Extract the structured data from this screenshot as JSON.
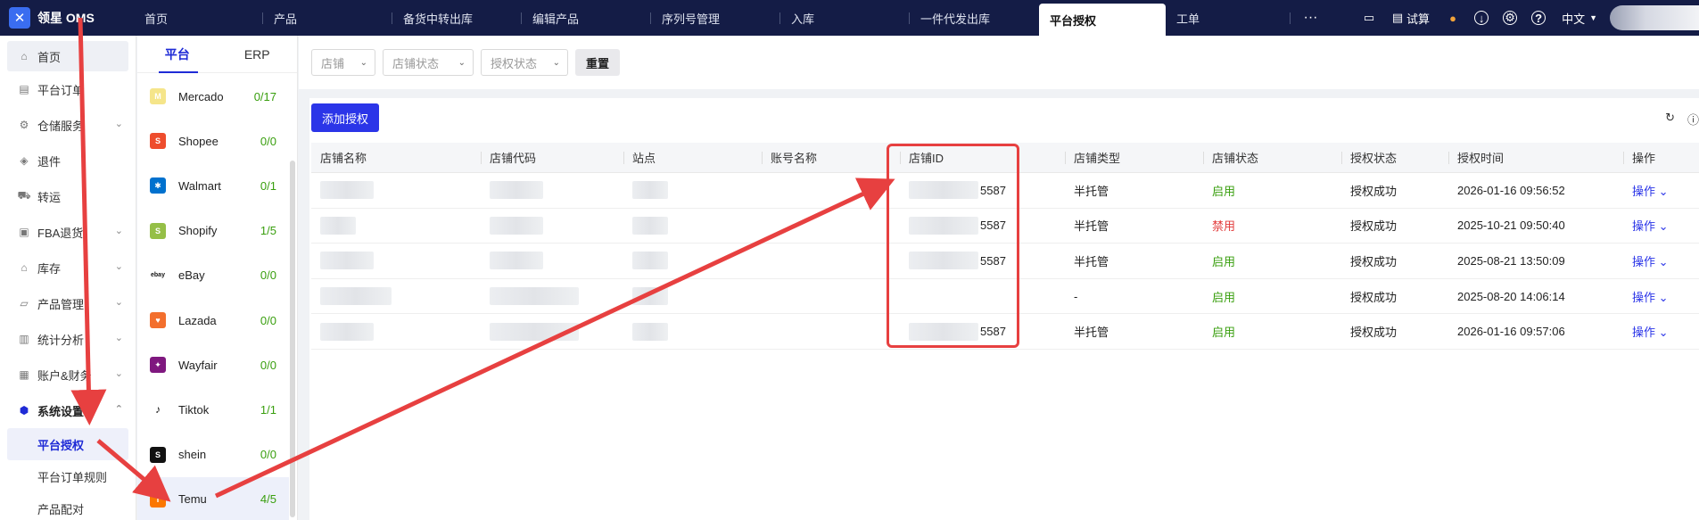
{
  "app": {
    "title": "领星 OMS"
  },
  "nav": {
    "tabs": [
      {
        "label": "首页"
      },
      {
        "label": "产品"
      },
      {
        "label": "备货中转出库"
      },
      {
        "label": "编辑产品"
      },
      {
        "label": "序列号管理"
      },
      {
        "label": "入库"
      },
      {
        "label": "一件代发出库"
      },
      {
        "label": "平台授权",
        "active": true
      },
      {
        "label": "工单"
      }
    ],
    "more": "···",
    "right": {
      "trial": "试算",
      "lang": "中文"
    }
  },
  "sidebar": {
    "items": [
      {
        "label": "首页",
        "icon": "home-icon"
      },
      {
        "label": "平台订单",
        "icon": "order-icon"
      },
      {
        "label": "仓储服务",
        "icon": "warehouse-icon",
        "chevron": "⌄"
      },
      {
        "label": "退件",
        "icon": "return-icon"
      },
      {
        "label": "转运",
        "icon": "transfer-icon"
      },
      {
        "label": "FBA退货",
        "icon": "fba-icon",
        "chevron": "⌄"
      },
      {
        "label": "库存",
        "icon": "inventory-icon",
        "chevron": "⌄"
      },
      {
        "label": "产品管理",
        "icon": "product-icon",
        "chevron": "⌄"
      },
      {
        "label": "统计分析",
        "icon": "stats-icon",
        "chevron": "⌄"
      },
      {
        "label": "账户&财务",
        "icon": "account-icon",
        "chevron": "⌄"
      },
      {
        "label": "系统设置",
        "icon": "settings-icon",
        "chevron": "⌃"
      }
    ],
    "sub": [
      {
        "label": "平台授权",
        "active": true
      },
      {
        "label": "平台订单规则"
      },
      {
        "label": "产品配对"
      }
    ]
  },
  "platform_panel": {
    "tabs": [
      "平台",
      "ERP"
    ],
    "list": [
      {
        "name": "Mercado",
        "count": "0/17",
        "color": "#f5e58a",
        "glyph": "M"
      },
      {
        "name": "Shopee",
        "count": "0/0",
        "color": "#ee4d2d",
        "glyph": "S"
      },
      {
        "name": "Walmart",
        "count": "0/1",
        "color": "#0071ce",
        "glyph": "✱"
      },
      {
        "name": "Shopify",
        "count": "1/5",
        "color": "#95bf47",
        "glyph": "S"
      },
      {
        "name": "eBay",
        "count": "0/0",
        "color": "#ffffff",
        "glyph": "ebay"
      },
      {
        "name": "Lazada",
        "count": "0/0",
        "color": "#f36f2d",
        "glyph": "♥"
      },
      {
        "name": "Wayfair",
        "count": "0/0",
        "color": "#7f187f",
        "glyph": "✦"
      },
      {
        "name": "Tiktok",
        "count": "1/1",
        "color": "#ffffff",
        "glyph": "♪"
      },
      {
        "name": "shein",
        "count": "0/0",
        "color": "#111111",
        "glyph": "S"
      },
      {
        "name": "Temu",
        "count": "4/5",
        "color": "#fb7701",
        "glyph": "T",
        "active": true
      }
    ]
  },
  "filters": {
    "store": "店铺",
    "store_status": "店铺状态",
    "auth_status": "授权状态",
    "reset": "重置"
  },
  "toolbar": {
    "add": "添加授权"
  },
  "table": {
    "columns": [
      "店铺名称",
      "店铺代码",
      "站点",
      "账号名称",
      "店铺ID",
      "店铺类型",
      "店铺状态",
      "授权状态",
      "授权时间",
      "操作"
    ],
    "rows": [
      {
        "store_id": "5587",
        "type": "半托管",
        "status": "启用",
        "status_kind": "ok",
        "auth": "授权成功",
        "time": "2026-01-16 09:56:52",
        "op": "操作 ⌄"
      },
      {
        "store_id": "5587",
        "type": "半托管",
        "status": "禁用",
        "status_kind": "off",
        "auth": "授权成功",
        "time": "2025-10-21 09:50:40",
        "op": "操作 ⌄"
      },
      {
        "store_id": "5587",
        "type": "半托管",
        "status": "启用",
        "status_kind": "ok",
        "auth": "授权成功",
        "time": "2025-08-21 13:50:09",
        "op": "操作 ⌄"
      },
      {
        "store_id": "",
        "type": "-",
        "status": "启用",
        "status_kind": "ok",
        "auth": "授权成功",
        "time": "2025-08-20 14:06:14",
        "op": "操作 ⌄"
      },
      {
        "store_id": "5587",
        "type": "半托管",
        "status": "启用",
        "status_kind": "ok",
        "auth": "授权成功",
        "time": "2026-01-16 09:57:06",
        "op": "操作 ⌄"
      }
    ]
  },
  "colors": {
    "primary": "#2b35e8",
    "topbar": "#141c46",
    "annotation": "#e74040",
    "ok": "#389e0d",
    "off": "#e23b3b"
  }
}
